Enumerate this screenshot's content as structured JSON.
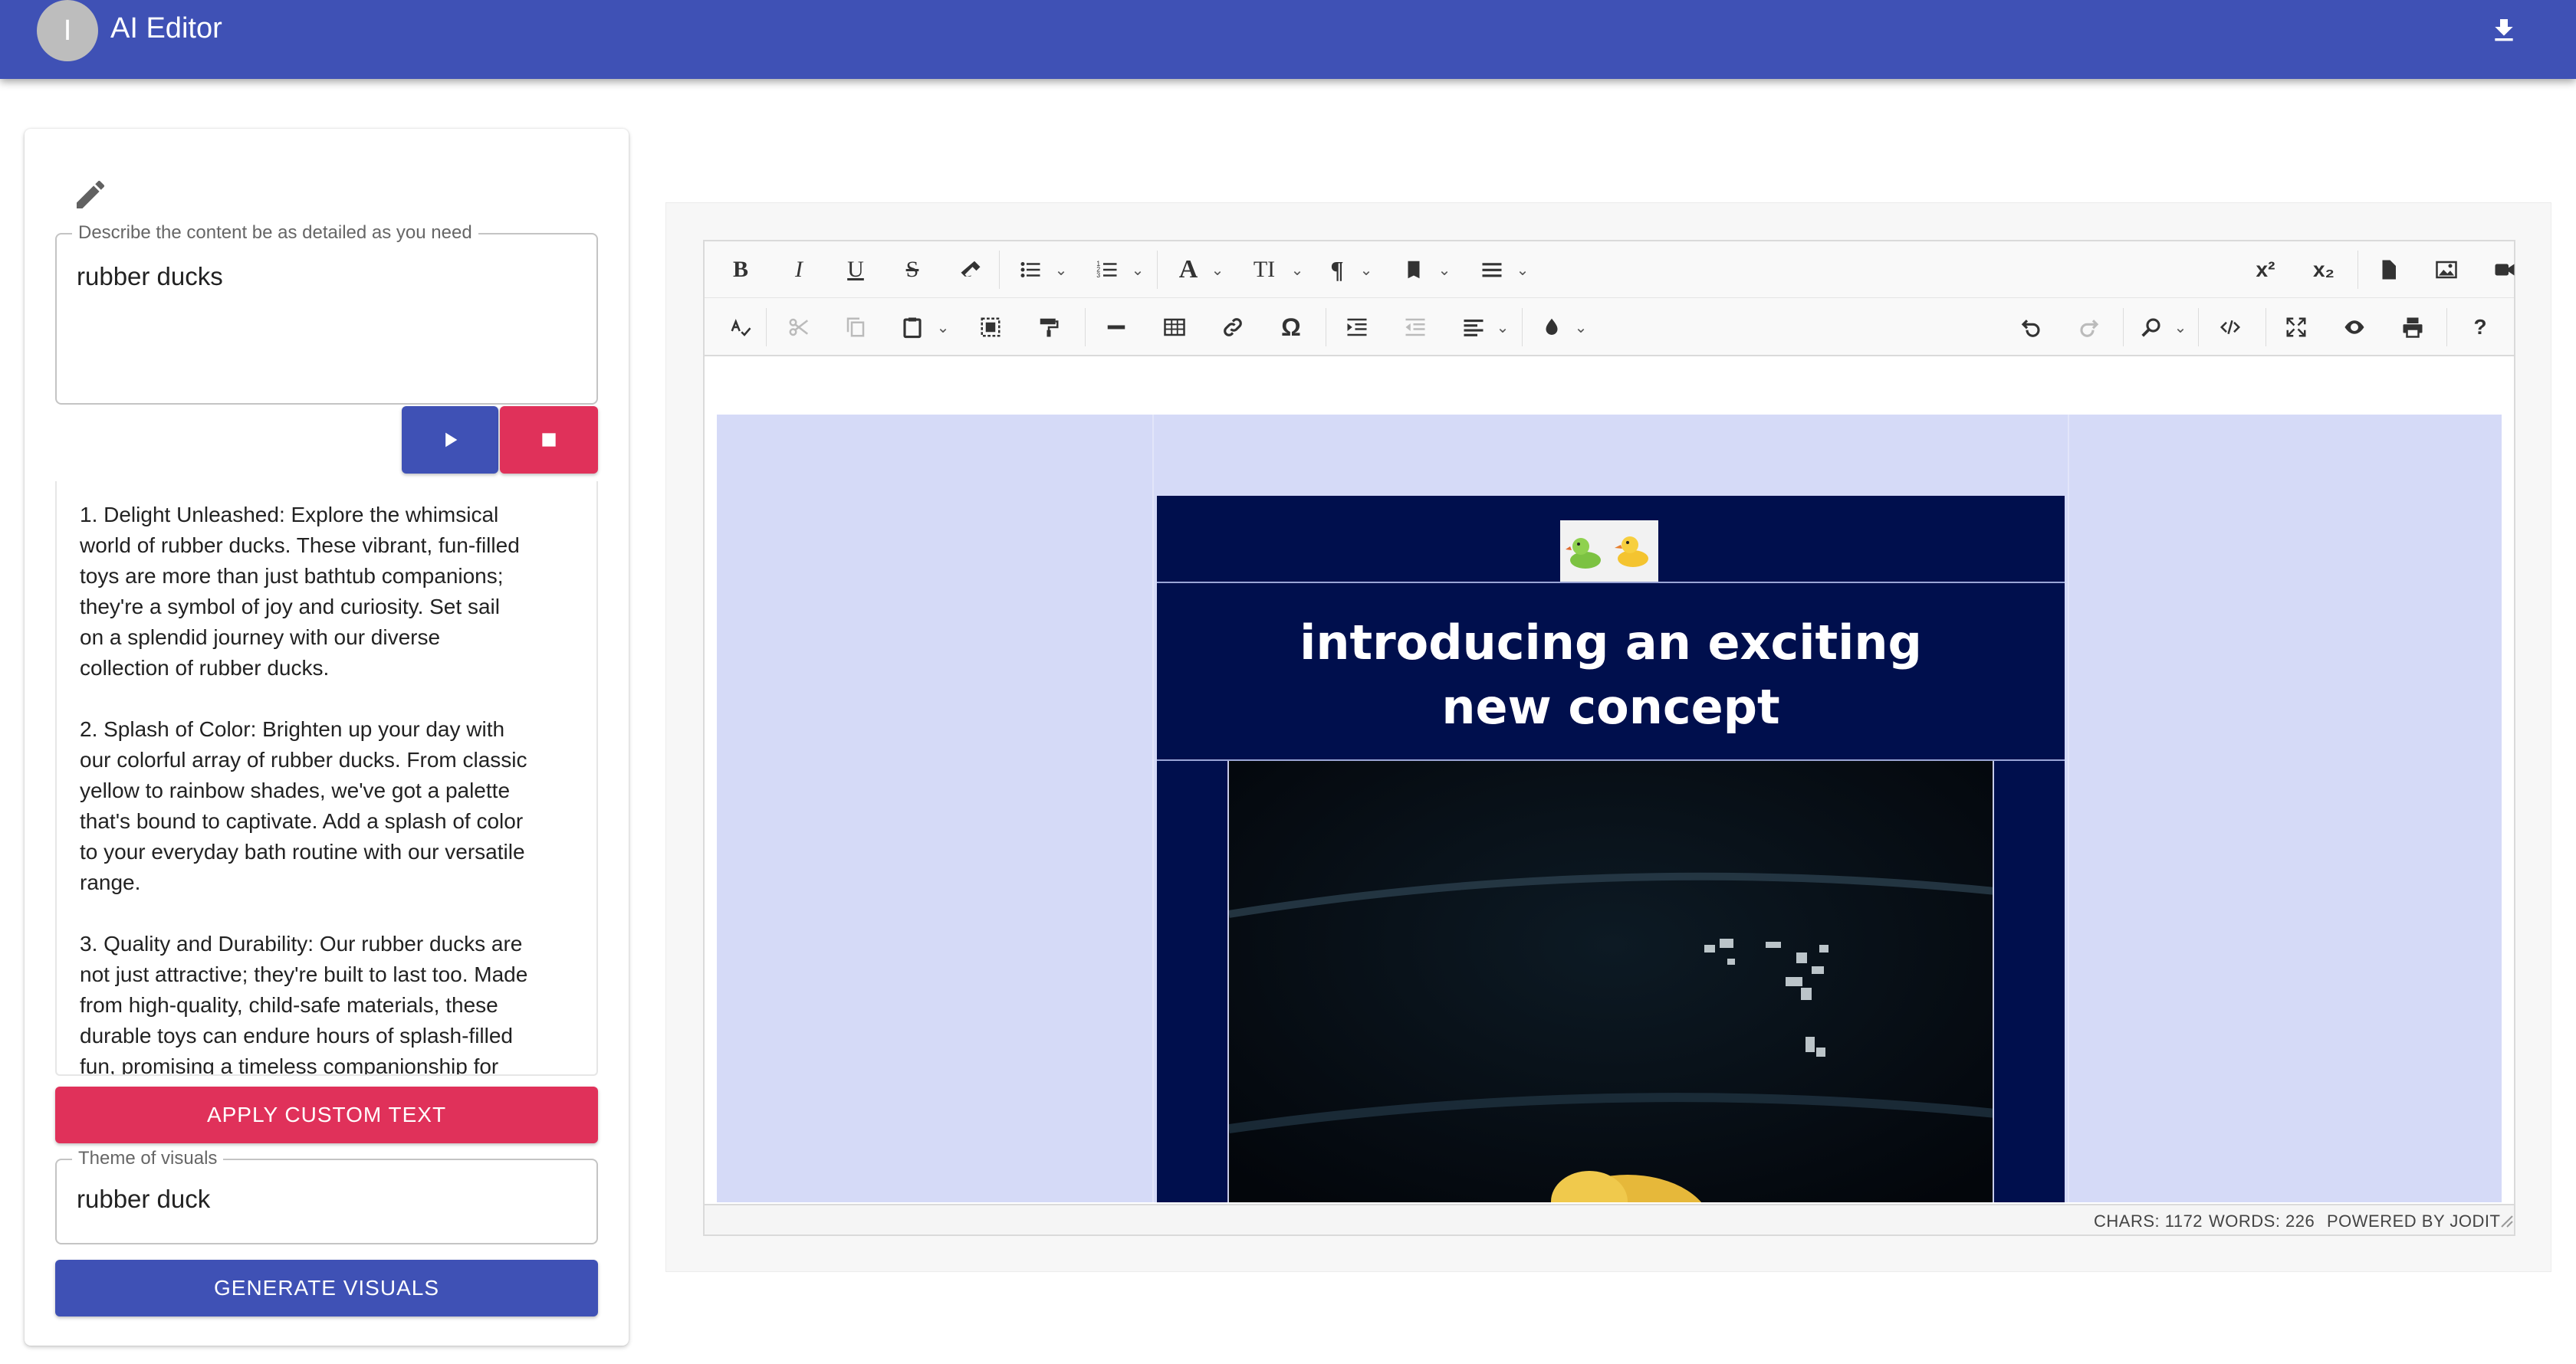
{
  "app": {
    "avatar_letter": "I",
    "title": "AI Editor"
  },
  "left_panel": {
    "description_legend": "Describe the content be as detailed as you need",
    "description_value": "rubber ducks",
    "generated_text": "1. Delight Unleashed: Explore the whimsical\nworld of rubber ducks. These vibrant, fun-filled\ntoys are more than just bathtub companions;\nthey're a symbol of joy and curiosity. Set sail\non a splendid journey with our diverse\ncollection of rubber ducks.\n\n2. Splash of Color: Brighten up your day with\nour colorful array of rubber ducks. From classic\nyellow to rainbow shades, we've got a palette\nthat's bound to captivate. Add a splash of color\nto your everyday bath routine with our versatile\nrange.\n\n3. Quality and Durability: Our rubber ducks are\nnot just attractive; they're built to last too. Made\nfrom high-quality, child-safe materials, these\ndurable toys can endure hours of splash-filled\nfun, promising a timeless companionship for",
    "apply_label": "APPLY CUSTOM TEXT",
    "theme_legend": "Theme of visuals",
    "theme_value": "rubber duck",
    "generate_label": "GENERATE VISUALS"
  },
  "toolbar": {
    "bold": "B",
    "italic": "I",
    "underline": "U",
    "strikethrough": "S",
    "font": "A",
    "font_size": "TI",
    "paragraph": "¶",
    "superscript": "x²",
    "subscript": "x₂",
    "special_char": "Ω",
    "help": "?"
  },
  "editor": {
    "headline_line1": "introducing an exciting",
    "headline_line2": "new concept",
    "logo_glyphs": "🦆 🦆"
  },
  "statusbar": {
    "chars": "CHARS: 1172",
    "words": "WORDS: 226",
    "powered": "POWERED BY JODIT"
  },
  "colors": {
    "primary": "#3f51b5",
    "accent": "#e0315a",
    "email_background": "#000f4d",
    "canvas_background": "#d5daf7"
  }
}
